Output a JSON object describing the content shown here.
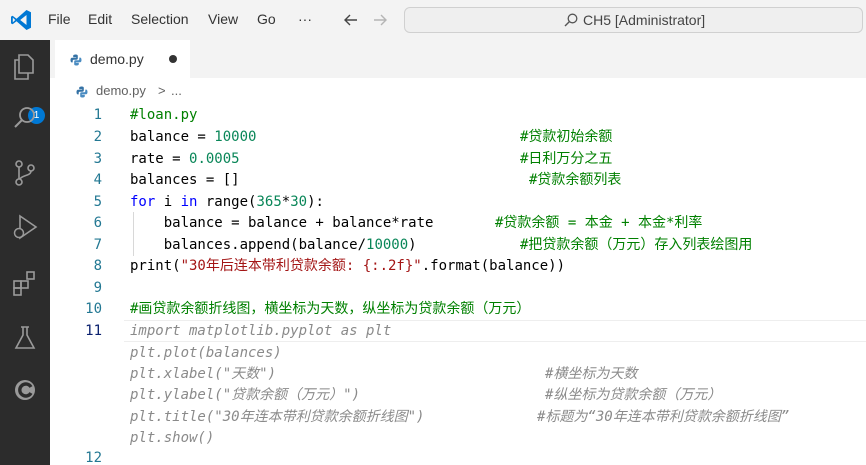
{
  "menu": {
    "file": "File",
    "edit": "Edit",
    "selection": "Selection",
    "view": "View",
    "go": "Go",
    "more": "···"
  },
  "command_center": {
    "text": "CH5 [Administrator]"
  },
  "activity": {
    "explorer_badge": "1"
  },
  "tab": {
    "label": "demo.py"
  },
  "breadcrumb": {
    "file": "demo.py",
    "sep": ">",
    "rest": "..."
  },
  "colors": {
    "activity_bg": "#2c2c2c",
    "badge": "#0078d4",
    "comment": "#008000",
    "keyword": "#0000ff",
    "number": "#098658",
    "string": "#a31515"
  },
  "editor": {
    "line_numbers": [
      "1",
      "2",
      "3",
      "4",
      "5",
      "6",
      "7",
      "8",
      "9",
      "10",
      "11",
      "12"
    ],
    "lines": {
      "l1": "#loan.py",
      "l2_code": "balance = ",
      "l2_num": "10000",
      "l2_cmt": "#贷款初始余额",
      "l3_code": "rate = ",
      "l3_num": "0.0005",
      "l3_cmt": "#日利万分之五",
      "l4_code": "balances = []",
      "l4_cmt": "#贷款余额列表",
      "l5_kw1": "for",
      "l5_a": " i ",
      "l5_kw2": "in",
      "l5_b": " range(",
      "l5_n1": "365",
      "l5_c": "*",
      "l5_n2": "30",
      "l5_d": "):",
      "l6_code": "    balance = balance + balance*rate",
      "l6_cmt": "#贷款余额 = 本金 + 本金*利率",
      "l7_code": "    balances.append(balance/",
      "l7_num": "10000",
      "l7_end": ")",
      "l7_cmt": "#把贷款余额（万元）存入列表绘图用",
      "l8_a": "print(",
      "l8_str": "\"30年后连本带利贷款余额: {:.2f}\"",
      "l8_b": ".format(balance))",
      "l10": "#画贷款余额折线图，横坐标为天数，纵坐标为贷款余额（万元）",
      "g1": "import matplotlib.pyplot as plt",
      "g2": "plt.plot(balances)",
      "g3_code": "plt.xlabel(\"天数\")",
      "g3_cmt": "#横坐标为天数",
      "g4_code": "plt.ylabel(\"贷款余额（万元）\")",
      "g4_cmt": "#纵坐标为贷款余额（万元）",
      "g5_code": "plt.title(\"30年连本带利贷款余额折线图\")",
      "g5_cmt": "#标题为“30年连本带利贷款余额折线图”",
      "g6": "plt.show()"
    }
  }
}
